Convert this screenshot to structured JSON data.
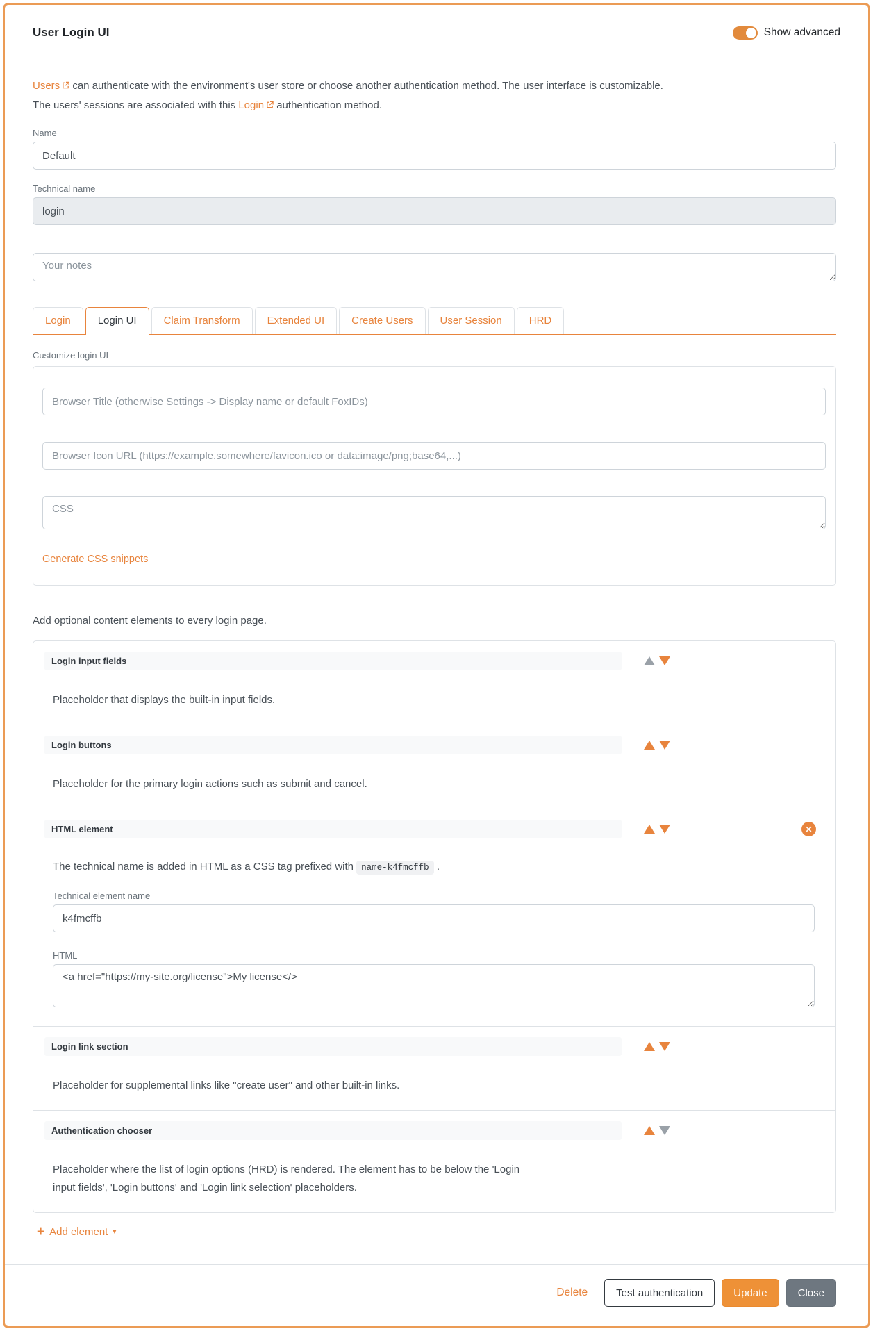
{
  "header": {
    "title": "User Login UI",
    "show_advanced_label": "Show advanced"
  },
  "intro": {
    "line1_link": "Users",
    "line1_text": " can authenticate with the environment's user store or choose another authentication method. The user interface is customizable.",
    "line2_prefix": "The users' sessions are associated with this ",
    "line2_link": "Login",
    "line2_suffix": " authentication method."
  },
  "fields": {
    "name": {
      "label": "Name",
      "value": "Default"
    },
    "technical_name": {
      "label": "Technical name",
      "value": "login"
    },
    "notes": {
      "placeholder": "Your notes"
    }
  },
  "tabs": {
    "active": "Login UI",
    "items": [
      {
        "label": "Login"
      },
      {
        "label": "Login UI"
      },
      {
        "label": "Claim Transform"
      },
      {
        "label": "Extended UI"
      },
      {
        "label": "Create Users"
      },
      {
        "label": "User Session"
      },
      {
        "label": "HRD"
      }
    ]
  },
  "customize": {
    "section_label": "Customize login UI",
    "browser_title_placeholder": "Browser Title (otherwise Settings -> Display name or default FoxIDs)",
    "browser_icon_placeholder": "Browser Icon URL (https://example.somewhere/favicon.ico or data:image/png;base64,...)",
    "css_placeholder": "CSS",
    "generate_link": "Generate CSS snippets"
  },
  "elements": {
    "intro": "Add optional content elements to every login page.",
    "items": [
      {
        "title": "Login input fields",
        "description": "Placeholder that displays the built-in input fields."
      },
      {
        "title": "Login buttons",
        "description": "Placeholder for the primary login actions such as submit and cancel."
      },
      {
        "title": "HTML element",
        "prefix_text": "The technical name is added in HTML as a CSS tag prefixed with",
        "code": "name-k4fmcffb",
        "suffix_text": ".",
        "technical_name_label": "Technical element name",
        "technical_name_value": "k4fmcffb",
        "html_label": "HTML",
        "html_value": "<a href=\"https://my-site.org/license\">My license</>"
      },
      {
        "title": "Login link section",
        "description": "Placeholder for supplemental links like \"create user\" and other built-in links."
      },
      {
        "title": "Authentication chooser",
        "description": "Placeholder where the list of login options (HRD) is rendered. The element has to be below the 'Login input fields', 'Login buttons' and 'Login link selection' placeholders."
      }
    ],
    "add_element_label": "Add element"
  },
  "footer": {
    "delete_label": "Delete",
    "test_label": "Test authentication",
    "update_label": "Update",
    "close_label": "Close"
  },
  "colors": {
    "accent_orange": "#e8843d",
    "button_orange": "#ee9137",
    "card_border_orange": "#eb9b55",
    "secondary_gray": "#6e7780",
    "row_strip_bg": "#f8f9fa",
    "disabled_input_bg": "#e9ecef"
  }
}
